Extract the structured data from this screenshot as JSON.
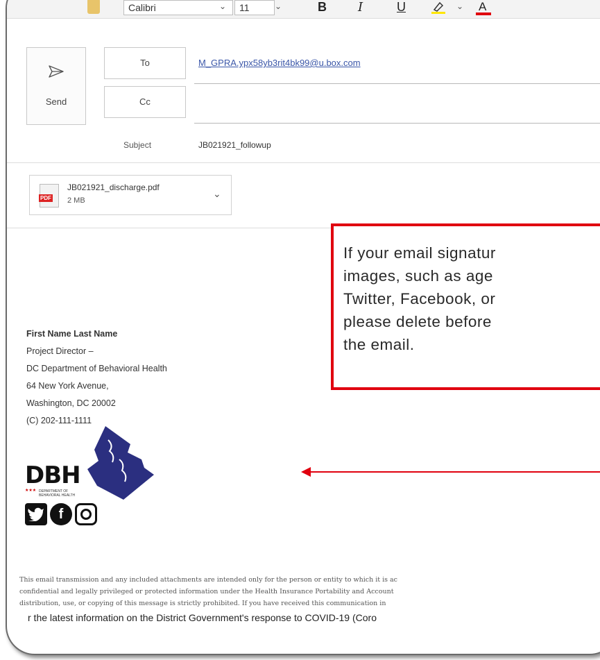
{
  "toolbar": {
    "font_name": "Calibri",
    "font_size": "11",
    "bold": "B",
    "italic": "I",
    "underline": "U",
    "font_color_label": "A"
  },
  "compose": {
    "send_label": "Send",
    "to_label": "To",
    "cc_label": "Cc",
    "to_value": "M_GPRA.ypx58yb3rit4bk99@u.box.com",
    "cc_value": "",
    "subject_label": "Subject",
    "subject_value": "JB021921_followup"
  },
  "attachment": {
    "filename": "JB021921_discharge.pdf",
    "size": "2 MB",
    "type_tag": "PDF"
  },
  "signature": {
    "name": "First Name Last Name",
    "title": "Project Director –",
    "org": "DC Department of Behavioral Health",
    "address1": "64 New York Avenue,",
    "address2": "Washington, DC 20002",
    "phone": "(C) 202-111-1111",
    "logo_text": "DBH",
    "logo_subtext": "DEPARTMENT OF BEHAVIORAL HEALTH"
  },
  "disclaimer": {
    "line1": "This email transmission and any included attachments are intended only for the person or entity to which it is ac",
    "line2": "confidential and legally privileged or protected information under the Health Insurance Portability and Account",
    "line3": "distribution, use, or copying of this message is strictly prohibited.  If you have received this communication in",
    "covid_line": "r the latest information on the District Government's response to COVID-19 (Coro"
  },
  "callout": {
    "line1": "If your email signatur",
    "line2": "images, such as age",
    "line3": "Twitter, Facebook, or",
    "line4": "please delete before",
    "line5": "the email."
  },
  "colors": {
    "callout_border": "#e0000f",
    "link": "#3a56a8",
    "dc_map": "#2b2f80"
  }
}
